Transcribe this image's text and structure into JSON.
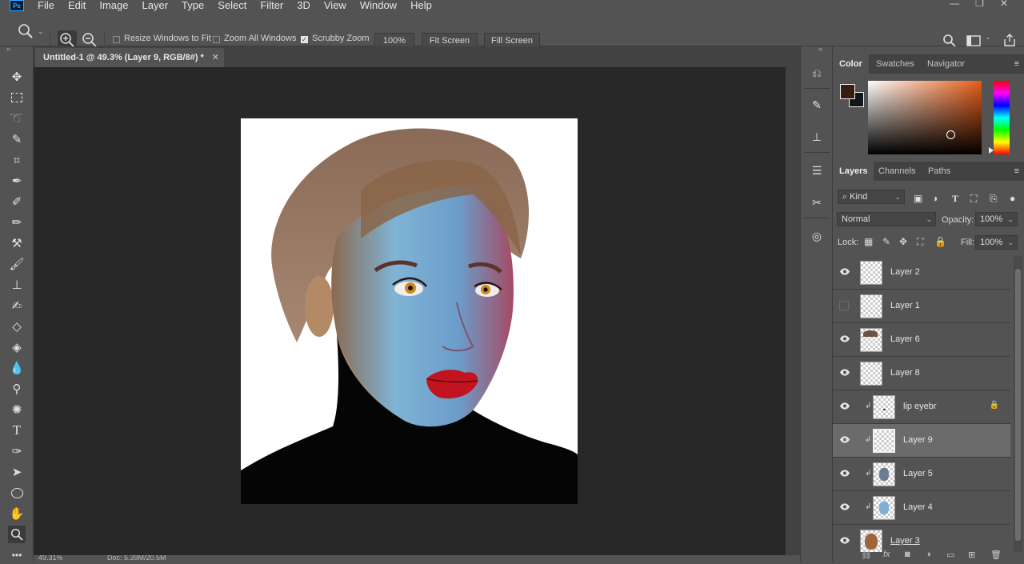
{
  "menubar": {
    "logo": "Ps",
    "items": [
      "File",
      "Edit",
      "Image",
      "Layer",
      "Type",
      "Select",
      "Filter",
      "3D",
      "View",
      "Window",
      "Help"
    ]
  },
  "options": {
    "resize_windows": "Resize Windows to Fit",
    "zoom_all": "Zoom All Windows",
    "scrubby_zoom": "Scrubby Zoom",
    "zoom_value": "100%",
    "fit_screen": "Fit Screen",
    "fill_screen": "Fill Screen"
  },
  "document": {
    "tab_title": "Untitled-1 @ 49.3% (Layer 9, RGB/8#) *",
    "status_zoom": "49.31%",
    "status_doc": "Doc: 5.39M/20.5M"
  },
  "color_panel": {
    "tabs": [
      "Color",
      "Swatches",
      "Navigator"
    ],
    "foreground": "#3a1d12",
    "background": "#0f1816"
  },
  "layers_panel": {
    "tabs": [
      "Layers",
      "Channels",
      "Paths"
    ],
    "kind_filter": "Kind",
    "blend_mode": "Normal",
    "opacity_label": "Opacity:",
    "opacity_value": "100%",
    "lock_label": "Lock:",
    "fill_label": "Fill:",
    "fill_value": "100%",
    "layers": [
      {
        "name": "Layer 2",
        "visible": true,
        "clipped": false,
        "locked": false,
        "selected": false
      },
      {
        "name": "Layer 1",
        "visible": false,
        "clipped": false,
        "locked": false,
        "selected": false
      },
      {
        "name": "Layer 6",
        "visible": true,
        "clipped": false,
        "locked": false,
        "selected": false
      },
      {
        "name": "Layer 8",
        "visible": true,
        "clipped": false,
        "locked": false,
        "selected": false
      },
      {
        "name": "lip eyebr",
        "visible": true,
        "clipped": true,
        "locked": true,
        "selected": false
      },
      {
        "name": "Layer 9",
        "visible": true,
        "clipped": true,
        "locked": false,
        "selected": true
      },
      {
        "name": "Layer 5",
        "visible": true,
        "clipped": true,
        "locked": false,
        "selected": false
      },
      {
        "name": "Layer 4",
        "visible": true,
        "clipped": true,
        "locked": false,
        "selected": false
      },
      {
        "name": "Layer 3",
        "visible": true,
        "clipped": false,
        "locked": false,
        "selected": false
      }
    ]
  }
}
